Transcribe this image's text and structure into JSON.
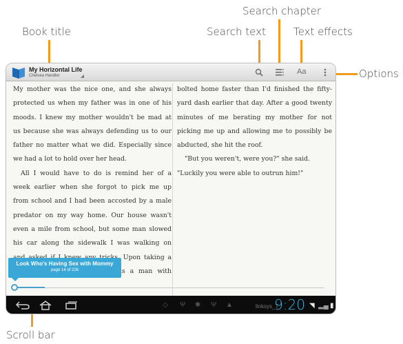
{
  "callouts": {
    "book_title": "Book title",
    "search_chapter": "Search chapter",
    "search_text": "Search text",
    "text_effects": "Text effects",
    "options": "Options",
    "scroll_bar": "Scroll bar"
  },
  "header": {
    "book_title": "My Horizontal Life",
    "author": "Chelsea Handler",
    "icons": [
      "search-icon",
      "chapter-list-icon",
      "text-effects-icon",
      "options-icon"
    ],
    "text_effects_label": "Aa"
  },
  "page_left": [
    "My mother was the nice one, and she always",
    "protected us when my father was in one of his",
    "moods. I knew my mother wouldn't be mad at",
    "us because she was always defending us to our",
    "father no matter what we did. Especially since",
    "we had a lot to hold over her head.",
    "All I would have to do is remind her of a",
    "week earlier when she forgot to pick me up",
    "from school and I had been accosted by a male",
    "predator on my way home. Our house wasn't",
    "even a mile from school, but some man slowed",
    "his car along the sidewalk I was walking on",
    "and asked if I knew any tricks. Upon taking a",
    "step back, I found out he was a man with"
  ],
  "page_right": [
    "bolted home faster than I'd finished the fifty-",
    "yard dash earlier that day. After a good twenty",
    "minutes of me berating my mother for not",
    "picking me up and allowing me to possibly be",
    "abducted, she hit the roof.",
    "\"But you weren't, were you?\" she said.",
    "\"Luckily you were able to outrun him!\""
  ],
  "tooltip": {
    "chapter": "Look Who's Having Sex with Mommy",
    "page": "page 14 of 226"
  },
  "scroll": {
    "current_page": 14,
    "total_pages": 226
  },
  "statusbar": {
    "network": "linksys_T",
    "time": "9:20"
  },
  "colors": {
    "callout_line": "#f39a1c",
    "accent_blue": "#3aa7d6",
    "clock_blue": "#33b5e5"
  }
}
